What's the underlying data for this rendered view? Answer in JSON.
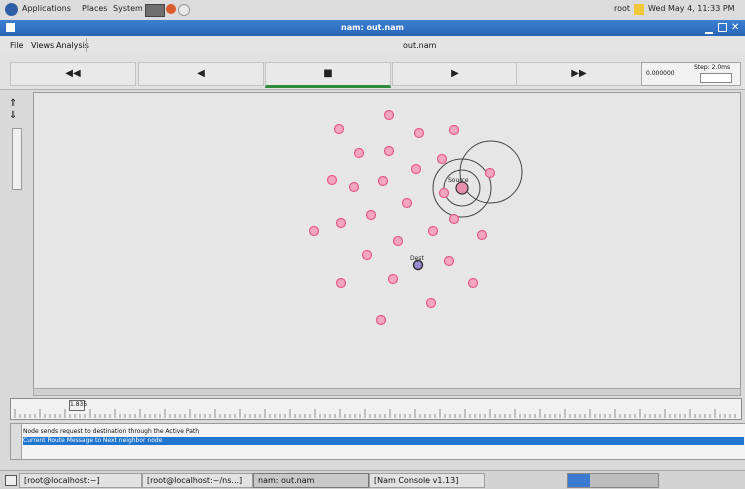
{
  "panel": {
    "menus": [
      "Applications",
      "Places",
      "System"
    ],
    "user": "root",
    "datetime": "Wed May 4, 11:33 PM"
  },
  "window": {
    "title": "nam: out.nam",
    "file_name": "out.nam"
  },
  "menubar": {
    "items": [
      "File",
      "Views",
      "Analysis"
    ]
  },
  "playback": {
    "rewind": "◀◀",
    "back": "◀",
    "stop": "■",
    "play": "▶",
    "forward": "▶▶",
    "time_label": "0.000000",
    "step_label": "Step: 2.0ms"
  },
  "nodes": {
    "labels": [
      "Source",
      "Dest"
    ]
  },
  "timeline": {
    "marker": "1.835"
  },
  "annotation": {
    "lines": [
      "Node sends request to destination through the Active Path",
      "Current Route Message to Next neighbor node"
    ]
  },
  "taskbar": {
    "items": [
      "[root@localhost:~]",
      "[root@localhost:~/ns...]",
      "nam: out.nam",
      "[Nam Console v1.13]"
    ]
  }
}
